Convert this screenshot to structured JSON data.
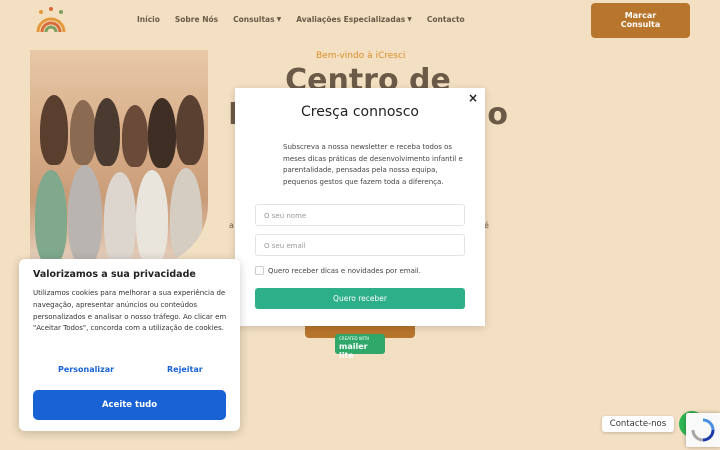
{
  "nav": {
    "items": [
      {
        "label": "Início"
      },
      {
        "label": "Sobre Nós"
      },
      {
        "label": "Consultas",
        "dropdown": true
      },
      {
        "label": "Avaliações Especializadas",
        "dropdown": true
      },
      {
        "label": "Contacto"
      }
    ],
    "cta_line1": "Marcar",
    "cta_line2": "Consulta"
  },
  "hero": {
    "welcome": "Bem-vindo à iCresci",
    "title_line1": "Centro de",
    "title_line2_left": "D",
    "title_line2_right": "o",
    "small_left": "a",
    "small_right": "é"
  },
  "badge": {
    "small": "CREATED WITH",
    "big": "mailer lite"
  },
  "modal": {
    "title": "Cresça connosco",
    "close": "×",
    "text": "Subscreva a nossa newsletter e receba todos os meses dicas práticas de desenvolvimento infantil e parentalidade, pensadas pela nossa equipa, pequenos gestos que fazem toda a diferença.",
    "name_placeholder": "O seu nome",
    "email_placeholder": "O seu email",
    "checkbox_label": "Quero receber dicas e novidades por email.",
    "submit": "Quero receber"
  },
  "cookie": {
    "title": "Valorizamos a sua privacidade",
    "text": "Utilizamos cookies para melhorar a sua experiência de navegação, apresentar anúncios ou conteúdos personalizados e analisar o nosso tráfego. Ao clicar em \"Aceitar Todos\", concorda com a utilização de cookies.",
    "customize": "Personalizar",
    "reject": "Rejeitar",
    "accept": "Aceite tudo"
  },
  "contact_pill": "Contacte-nos",
  "colors": {
    "background": "#f3dfc1",
    "brand": "#b8752c",
    "modal_button": "#2daf8a",
    "cookie_accent": "#1862d6"
  }
}
